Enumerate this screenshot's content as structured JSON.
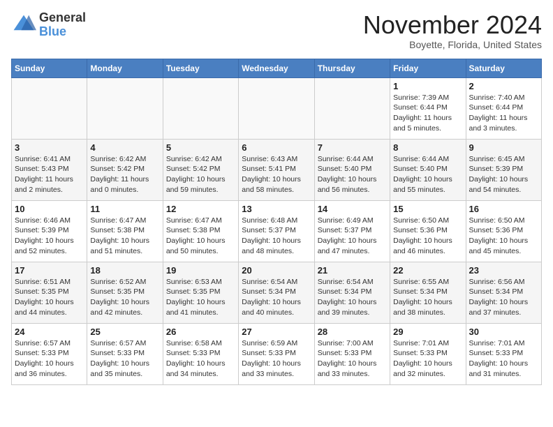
{
  "logo": {
    "general": "General",
    "blue": "Blue"
  },
  "title": "November 2024",
  "subtitle": "Boyette, Florida, United States",
  "weekdays": [
    "Sunday",
    "Monday",
    "Tuesday",
    "Wednesday",
    "Thursday",
    "Friday",
    "Saturday"
  ],
  "weeks": [
    [
      {
        "day": "",
        "info": ""
      },
      {
        "day": "",
        "info": ""
      },
      {
        "day": "",
        "info": ""
      },
      {
        "day": "",
        "info": ""
      },
      {
        "day": "",
        "info": ""
      },
      {
        "day": "1",
        "info": "Sunrise: 7:39 AM\nSunset: 6:44 PM\nDaylight: 11 hours and 5 minutes."
      },
      {
        "day": "2",
        "info": "Sunrise: 7:40 AM\nSunset: 6:44 PM\nDaylight: 11 hours and 3 minutes."
      }
    ],
    [
      {
        "day": "3",
        "info": "Sunrise: 6:41 AM\nSunset: 5:43 PM\nDaylight: 11 hours and 2 minutes."
      },
      {
        "day": "4",
        "info": "Sunrise: 6:42 AM\nSunset: 5:42 PM\nDaylight: 11 hours and 0 minutes."
      },
      {
        "day": "5",
        "info": "Sunrise: 6:42 AM\nSunset: 5:42 PM\nDaylight: 10 hours and 59 minutes."
      },
      {
        "day": "6",
        "info": "Sunrise: 6:43 AM\nSunset: 5:41 PM\nDaylight: 10 hours and 58 minutes."
      },
      {
        "day": "7",
        "info": "Sunrise: 6:44 AM\nSunset: 5:40 PM\nDaylight: 10 hours and 56 minutes."
      },
      {
        "day": "8",
        "info": "Sunrise: 6:44 AM\nSunset: 5:40 PM\nDaylight: 10 hours and 55 minutes."
      },
      {
        "day": "9",
        "info": "Sunrise: 6:45 AM\nSunset: 5:39 PM\nDaylight: 10 hours and 54 minutes."
      }
    ],
    [
      {
        "day": "10",
        "info": "Sunrise: 6:46 AM\nSunset: 5:39 PM\nDaylight: 10 hours and 52 minutes."
      },
      {
        "day": "11",
        "info": "Sunrise: 6:47 AM\nSunset: 5:38 PM\nDaylight: 10 hours and 51 minutes."
      },
      {
        "day": "12",
        "info": "Sunrise: 6:47 AM\nSunset: 5:38 PM\nDaylight: 10 hours and 50 minutes."
      },
      {
        "day": "13",
        "info": "Sunrise: 6:48 AM\nSunset: 5:37 PM\nDaylight: 10 hours and 48 minutes."
      },
      {
        "day": "14",
        "info": "Sunrise: 6:49 AM\nSunset: 5:37 PM\nDaylight: 10 hours and 47 minutes."
      },
      {
        "day": "15",
        "info": "Sunrise: 6:50 AM\nSunset: 5:36 PM\nDaylight: 10 hours and 46 minutes."
      },
      {
        "day": "16",
        "info": "Sunrise: 6:50 AM\nSunset: 5:36 PM\nDaylight: 10 hours and 45 minutes."
      }
    ],
    [
      {
        "day": "17",
        "info": "Sunrise: 6:51 AM\nSunset: 5:35 PM\nDaylight: 10 hours and 44 minutes."
      },
      {
        "day": "18",
        "info": "Sunrise: 6:52 AM\nSunset: 5:35 PM\nDaylight: 10 hours and 42 minutes."
      },
      {
        "day": "19",
        "info": "Sunrise: 6:53 AM\nSunset: 5:35 PM\nDaylight: 10 hours and 41 minutes."
      },
      {
        "day": "20",
        "info": "Sunrise: 6:54 AM\nSunset: 5:34 PM\nDaylight: 10 hours and 40 minutes."
      },
      {
        "day": "21",
        "info": "Sunrise: 6:54 AM\nSunset: 5:34 PM\nDaylight: 10 hours and 39 minutes."
      },
      {
        "day": "22",
        "info": "Sunrise: 6:55 AM\nSunset: 5:34 PM\nDaylight: 10 hours and 38 minutes."
      },
      {
        "day": "23",
        "info": "Sunrise: 6:56 AM\nSunset: 5:34 PM\nDaylight: 10 hours and 37 minutes."
      }
    ],
    [
      {
        "day": "24",
        "info": "Sunrise: 6:57 AM\nSunset: 5:33 PM\nDaylight: 10 hours and 36 minutes."
      },
      {
        "day": "25",
        "info": "Sunrise: 6:57 AM\nSunset: 5:33 PM\nDaylight: 10 hours and 35 minutes."
      },
      {
        "day": "26",
        "info": "Sunrise: 6:58 AM\nSunset: 5:33 PM\nDaylight: 10 hours and 34 minutes."
      },
      {
        "day": "27",
        "info": "Sunrise: 6:59 AM\nSunset: 5:33 PM\nDaylight: 10 hours and 33 minutes."
      },
      {
        "day": "28",
        "info": "Sunrise: 7:00 AM\nSunset: 5:33 PM\nDaylight: 10 hours and 33 minutes."
      },
      {
        "day": "29",
        "info": "Sunrise: 7:01 AM\nSunset: 5:33 PM\nDaylight: 10 hours and 32 minutes."
      },
      {
        "day": "30",
        "info": "Sunrise: 7:01 AM\nSunset: 5:33 PM\nDaylight: 10 hours and 31 minutes."
      }
    ]
  ]
}
